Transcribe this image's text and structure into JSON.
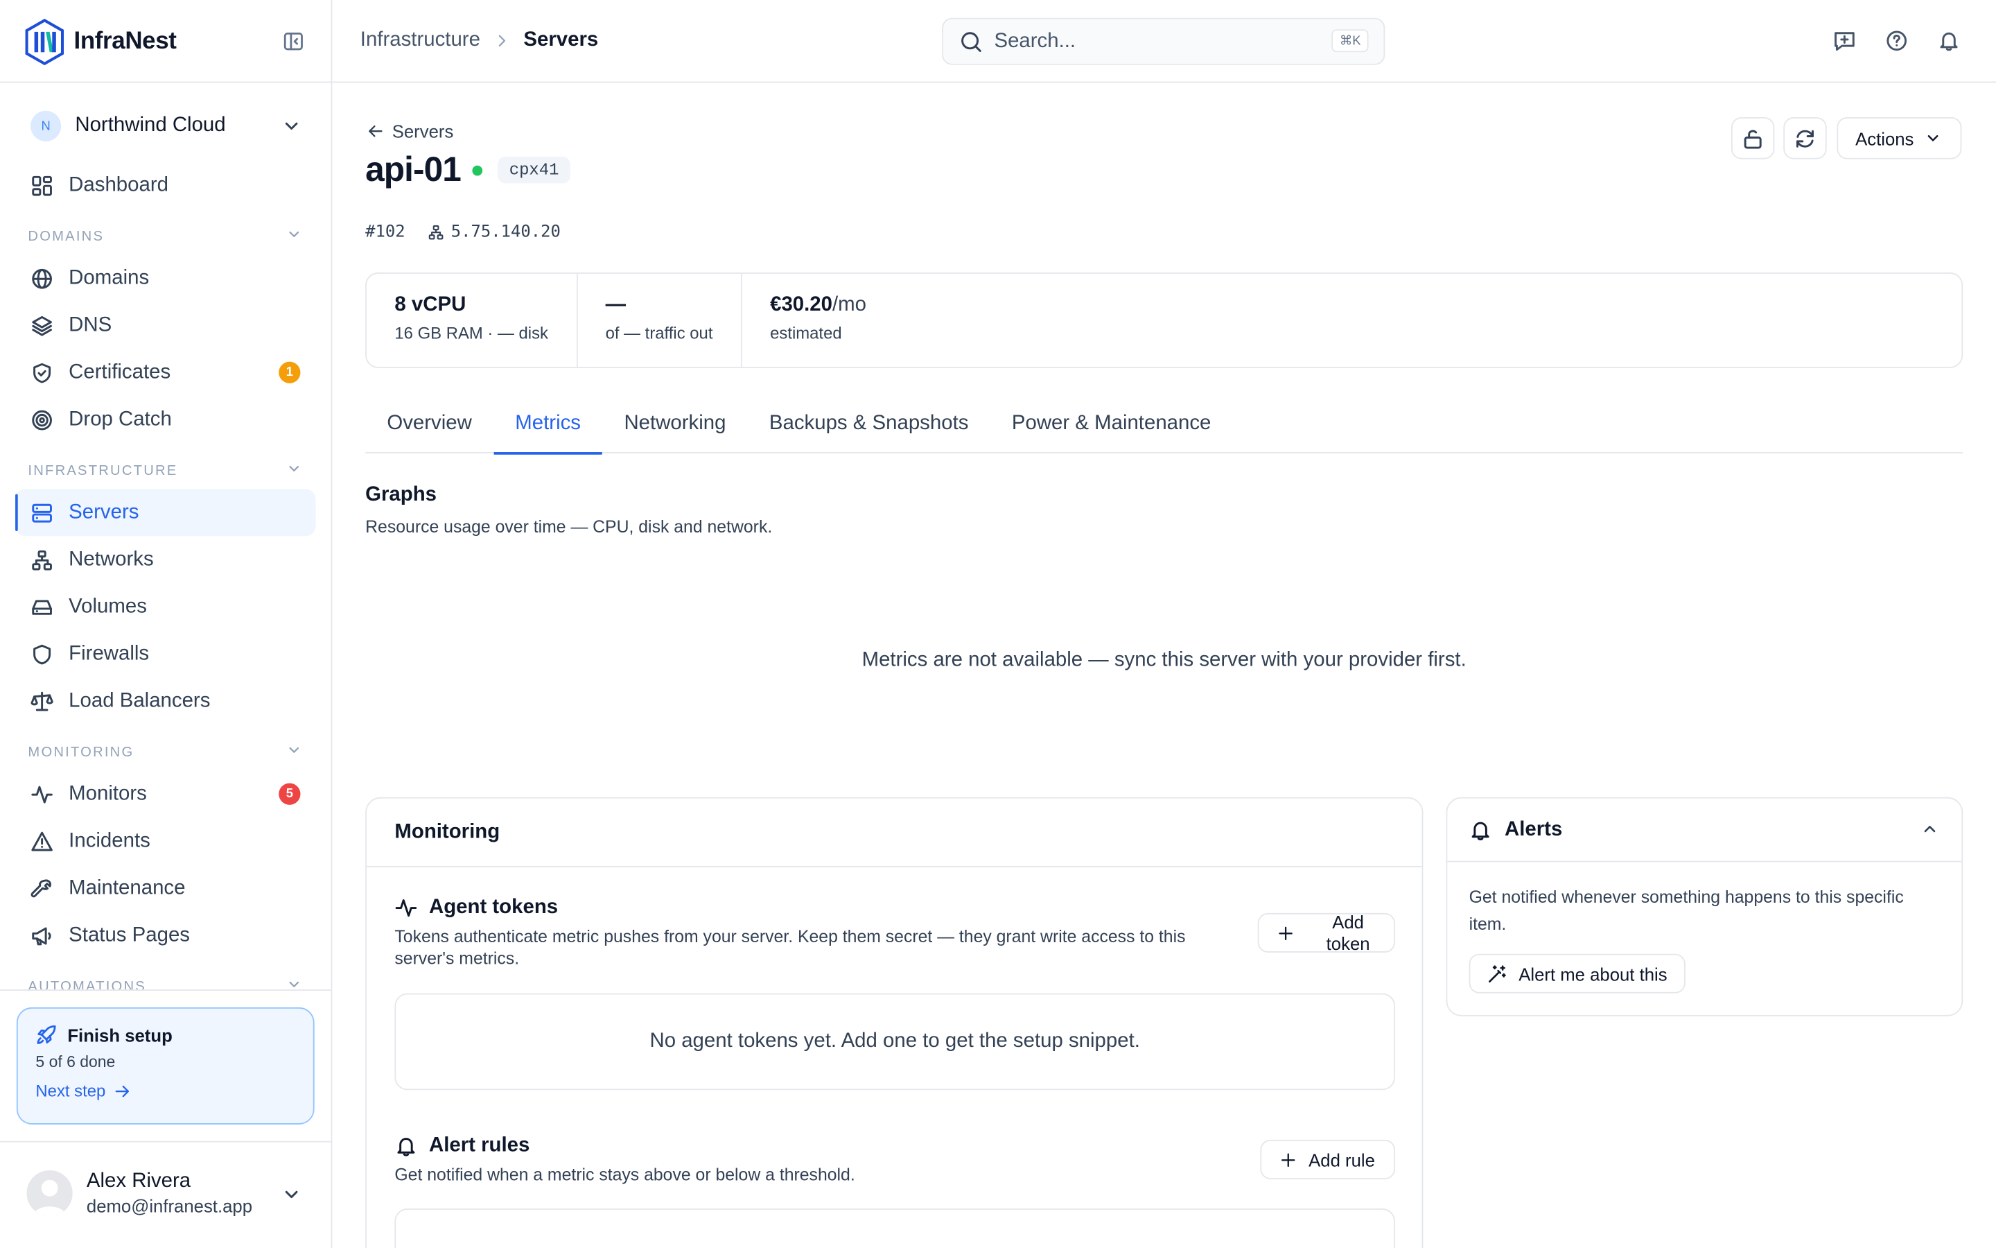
{
  "app": {
    "name": "InfraNest"
  },
  "org": {
    "initial": "N",
    "name": "Northwind Cloud"
  },
  "nav": {
    "dashboard": "Dashboard",
    "sections": {
      "domains": "DOMAINS",
      "infrastructure": "INFRASTRUCTURE",
      "monitoring": "MONITORING",
      "automations": "AUTOMATIONS"
    },
    "domains": [
      "Domains",
      "DNS",
      "Certificates",
      "Drop Catch"
    ],
    "certificates_badge": "1",
    "infrastructure": [
      "Servers",
      "Networks",
      "Volumes",
      "Firewalls",
      "Load Balancers"
    ],
    "monitoring": [
      "Monitors",
      "Incidents",
      "Maintenance",
      "Status Pages"
    ],
    "monitors_badge": "5",
    "badge_colors": {
      "certificates": "#f59e0b",
      "monitors": "#ef4444"
    }
  },
  "setup": {
    "title": "Finish setup",
    "progress": "5 of 6 done",
    "next": "Next step",
    "done": 5,
    "total": 6
  },
  "user": {
    "name": "Alex Rivera",
    "email": "demo@infranest.app"
  },
  "topbar": {
    "crumb_parent": "Infrastructure",
    "crumb_current": "Servers",
    "search_placeholder": "Search...",
    "search_shortcut": "⌘K"
  },
  "server": {
    "back": "Servers",
    "name": "api-01",
    "status": "running",
    "status_color": "#22c55e",
    "type": "cpx41",
    "id": "#102",
    "ip": "5.75.140.20",
    "actions": "Actions"
  },
  "stats": [
    {
      "value": "8 vCPU",
      "unit": "",
      "sub": "16 GB RAM · — disk"
    },
    {
      "value": "—",
      "unit": "",
      "sub": "of — traffic out"
    },
    {
      "value": "€30.20",
      "unit": "/mo",
      "sub": "estimated"
    }
  ],
  "tabs": [
    "Overview",
    "Metrics",
    "Networking",
    "Backups & Snapshots",
    "Power & Maintenance"
  ],
  "active_tab": "Metrics",
  "graphs": {
    "title": "Graphs",
    "subtitle": "Resource usage over time — CPU, disk and network.",
    "empty": "Metrics are not available — sync this server with your provider first."
  },
  "monitoring": {
    "title": "Monitoring",
    "tokens": {
      "title": "Agent tokens",
      "desc": "Tokens authenticate metric pushes from your server. Keep them secret — they grant write access to this server's metrics.",
      "add": "Add token",
      "empty": "No agent tokens yet. Add one to get the setup snippet."
    },
    "rules": {
      "title": "Alert rules",
      "desc": "Get notified when a metric stays above or below a threshold.",
      "add": "Add rule"
    }
  },
  "alerts": {
    "title": "Alerts",
    "desc": "Get notified whenever something happens to this specific item.",
    "button": "Alert me about this"
  },
  "accent": "#2563eb"
}
